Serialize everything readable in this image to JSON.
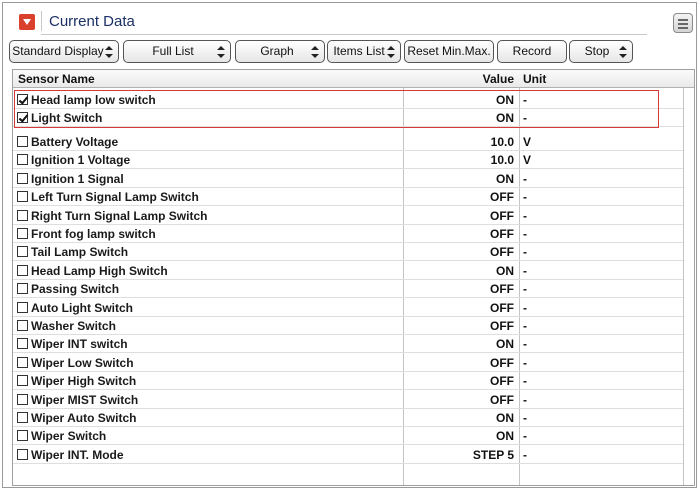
{
  "header": {
    "title": "Current Data"
  },
  "toolbar": {
    "buttons": [
      {
        "label": "Standard Display",
        "spinner": true
      },
      {
        "label": "Full List",
        "spinner": true
      },
      {
        "label": "Graph",
        "spinner": true
      },
      {
        "label": "Items List",
        "spinner": true
      },
      {
        "label": "Reset Min.Max.",
        "spinner": false
      },
      {
        "label": "Record",
        "spinner": false
      },
      {
        "label": "Stop",
        "spinner": true
      }
    ]
  },
  "table": {
    "columns": {
      "name": "Sensor Name",
      "value": "Value",
      "unit": "Unit"
    },
    "selected_rows": [
      {
        "name": "Head lamp low switch",
        "value": "ON",
        "unit": "-",
        "checked": true
      },
      {
        "name": "Light Switch",
        "value": "ON",
        "unit": "-",
        "checked": true
      }
    ],
    "rows": [
      {
        "name": "Battery Voltage",
        "value": "10.0",
        "unit": "V",
        "checked": false
      },
      {
        "name": "Ignition 1 Voltage",
        "value": "10.0",
        "unit": "V",
        "checked": false
      },
      {
        "name": "Ignition 1 Signal",
        "value": "ON",
        "unit": "-",
        "checked": false
      },
      {
        "name": "Left Turn Signal Lamp Switch",
        "value": "OFF",
        "unit": "-",
        "checked": false
      },
      {
        "name": "Right Turn Signal Lamp Switch",
        "value": "OFF",
        "unit": "-",
        "checked": false
      },
      {
        "name": "Front fog lamp switch",
        "value": "OFF",
        "unit": "-",
        "checked": false
      },
      {
        "name": "Tail Lamp Switch",
        "value": "OFF",
        "unit": "-",
        "checked": false
      },
      {
        "name": "Head Lamp High Switch",
        "value": "ON",
        "unit": "-",
        "checked": false
      },
      {
        "name": "Passing Switch",
        "value": "OFF",
        "unit": "-",
        "checked": false
      },
      {
        "name": "Auto Light Switch",
        "value": "OFF",
        "unit": "-",
        "checked": false
      },
      {
        "name": "Washer Switch",
        "value": "OFF",
        "unit": "-",
        "checked": false
      },
      {
        "name": "Wiper INT switch",
        "value": "ON",
        "unit": "-",
        "checked": false
      },
      {
        "name": "Wiper Low Switch",
        "value": "OFF",
        "unit": "-",
        "checked": false
      },
      {
        "name": "Wiper High Switch",
        "value": "OFF",
        "unit": "-",
        "checked": false
      },
      {
        "name": "Wiper MIST Switch",
        "value": "OFF",
        "unit": "-",
        "checked": false
      },
      {
        "name": "Wiper Auto Switch",
        "value": "ON",
        "unit": "-",
        "checked": false
      },
      {
        "name": "Wiper Switch",
        "value": "ON",
        "unit": "-",
        "checked": false
      },
      {
        "name": "Wiper INT. Mode",
        "value": "STEP 5",
        "unit": "-",
        "checked": false
      }
    ]
  },
  "icons": {
    "collapse": "collapse-arrow-icon",
    "menu": "list-menu-icon"
  },
  "colors": {
    "title": "#1a2f66",
    "accent": "#d9412c",
    "highlight": "#d63a3a"
  }
}
